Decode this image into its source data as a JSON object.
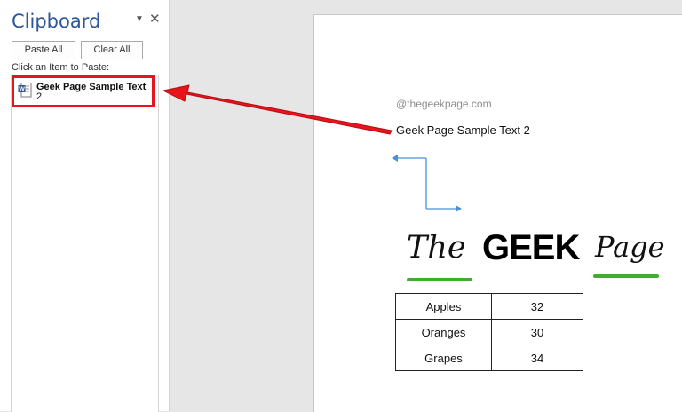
{
  "clipboard_pane": {
    "title": "Clipboard",
    "menu_icon": "dropdown-triangle-icon",
    "close_icon": "close-x-icon",
    "paste_all_label": "Paste All",
    "clear_all_label": "Clear All",
    "hint": "Click an Item to Paste:",
    "items": [
      {
        "icon": "word-document-icon",
        "text_line1": "Geek Page Sample Text",
        "text_line2": "2"
      }
    ]
  },
  "document": {
    "watermark": "@thegeekpage.com",
    "body_text": "Geek Page Sample Text 2",
    "logo": {
      "word1": "The",
      "word2": "GEEK",
      "word3": "Page"
    },
    "table": [
      [
        "Apples",
        "32"
      ],
      [
        "Oranges",
        "30"
      ],
      [
        "Grapes",
        "34"
      ]
    ]
  },
  "annotation": {
    "highlight_color": "#e8141b",
    "connector_color": "#4a90d9"
  }
}
